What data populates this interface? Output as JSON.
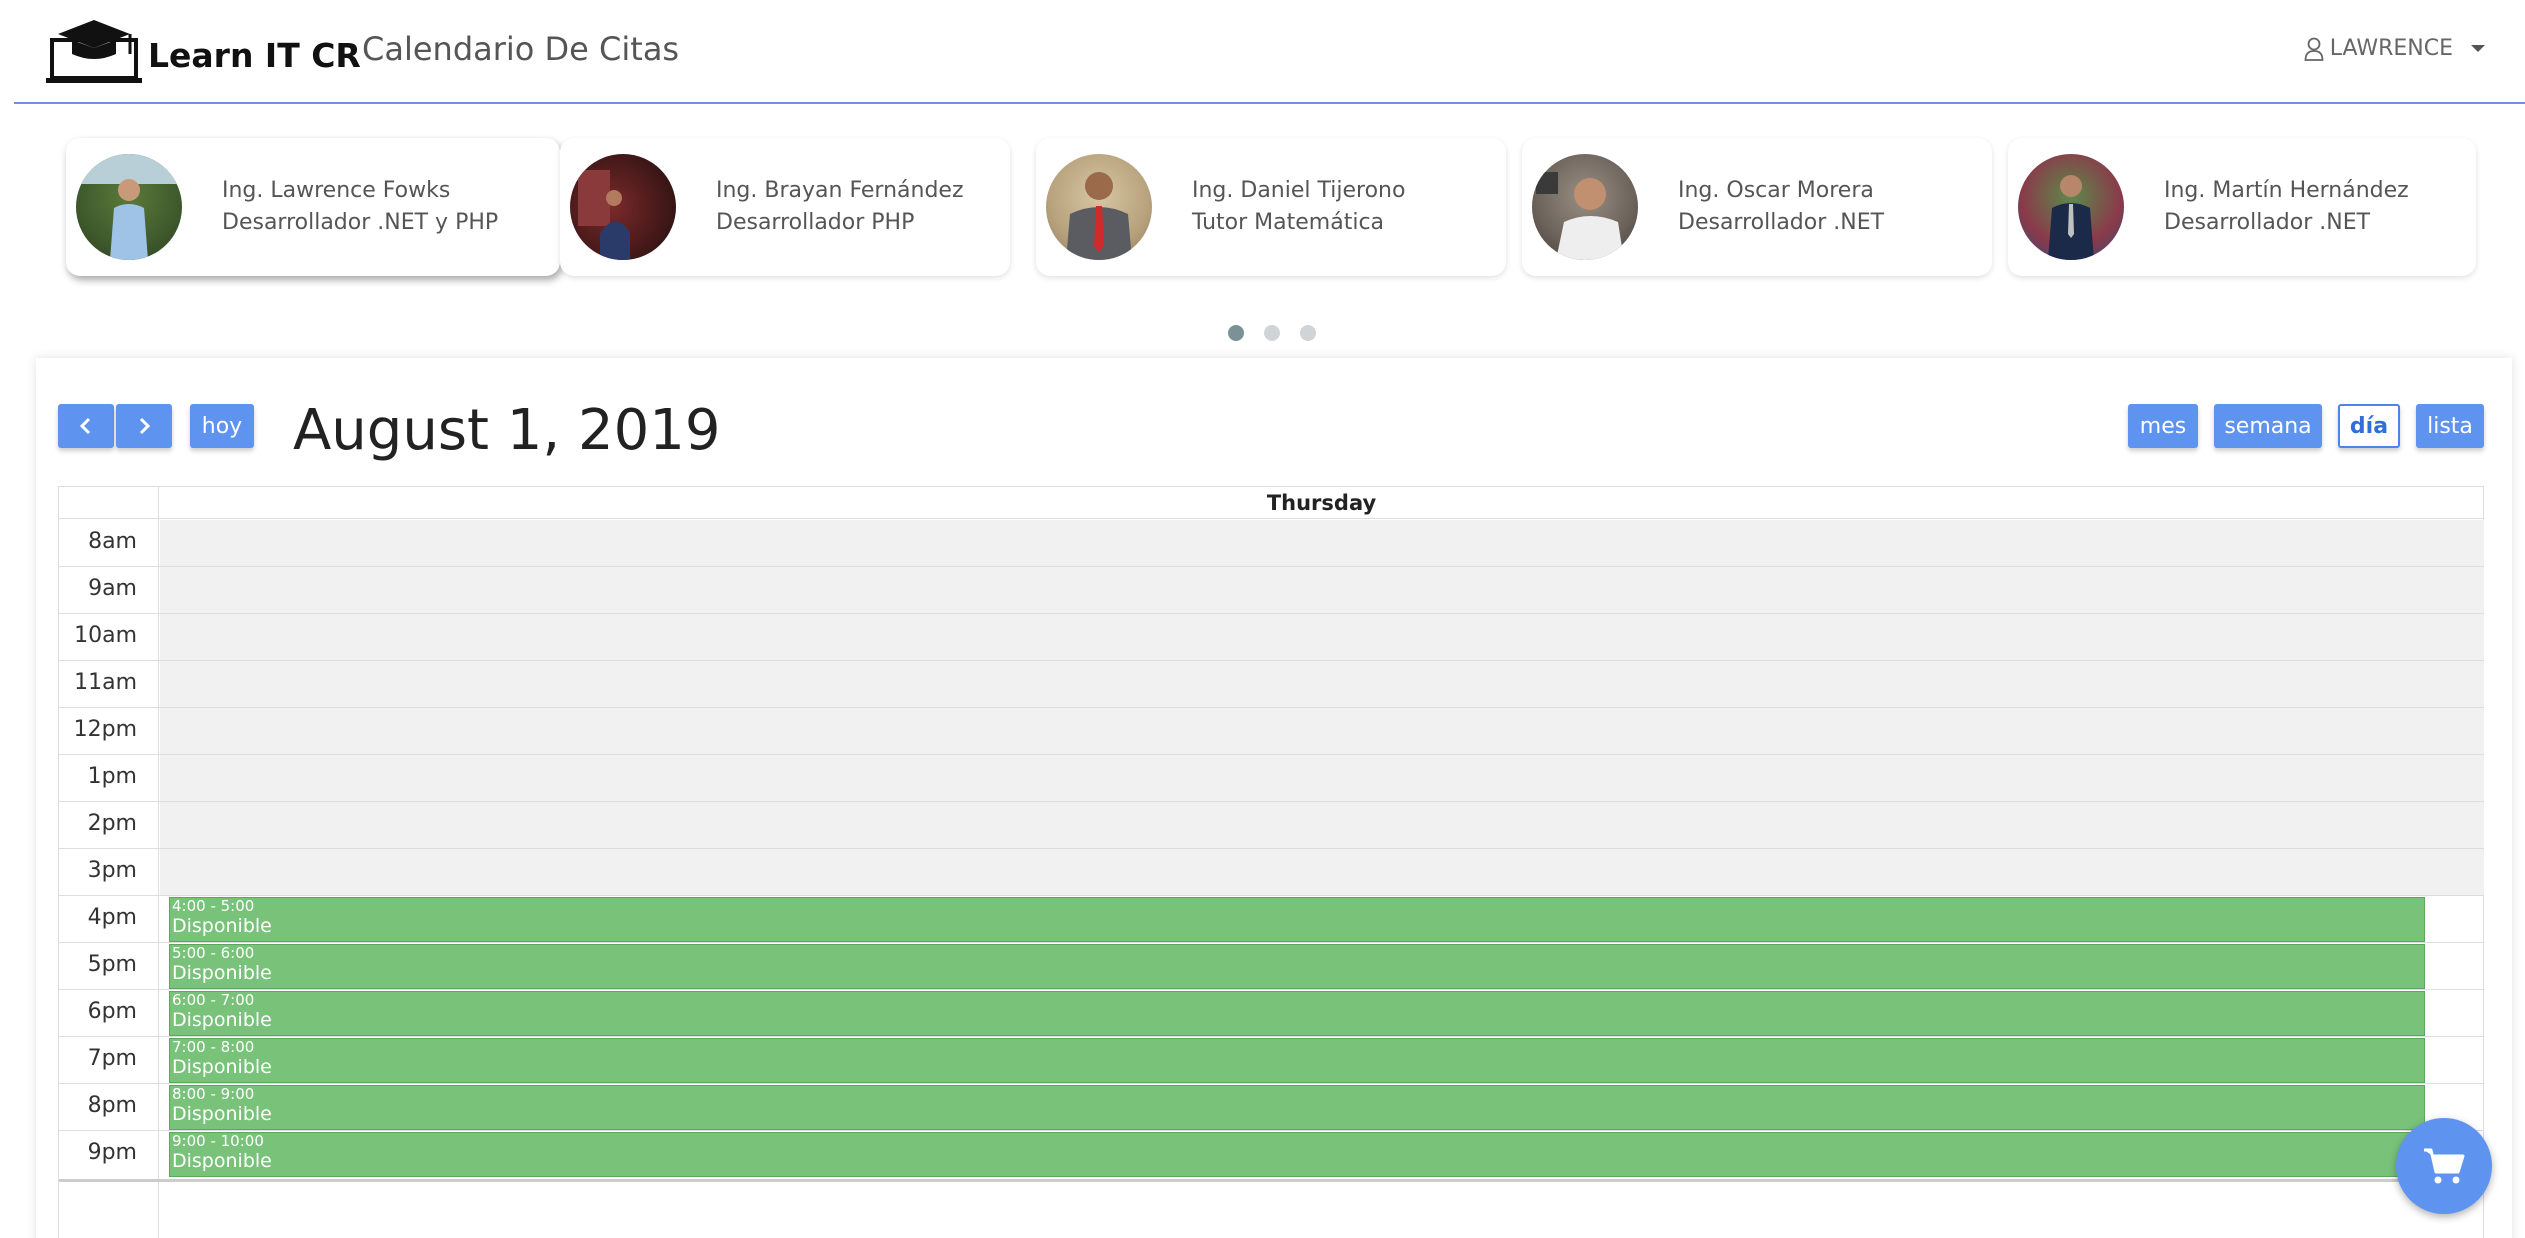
{
  "navbar": {
    "brand": "Learn IT CR",
    "title": "Calendario De Citas",
    "user": "LAWRENCE"
  },
  "tutors": [
    {
      "name": "Ing. Lawrence Fowks",
      "role": "Desarrollador .NET y PHP"
    },
    {
      "name": "Ing. Brayan Fernández",
      "role": "Desarrollador PHP"
    },
    {
      "name": "Ing. Daniel Tijerono",
      "role": "Tutor Matemática"
    },
    {
      "name": "Ing. Oscar Morera",
      "role": "Desarrollador .NET"
    },
    {
      "name": "Ing. Martín Hernández",
      "role": "Desarrollador .NET"
    }
  ],
  "carousel": {
    "pages": 3,
    "active": 1
  },
  "toolbar": {
    "prev_label": "<",
    "next_label": ">",
    "today_label": "hoy",
    "title": "August 1, 2019",
    "views": [
      "mes",
      "semana",
      "día",
      "lista"
    ],
    "active_view": "día"
  },
  "calendar": {
    "day_header": "Thursday",
    "times": [
      "8am",
      "9am",
      "10am",
      "11am",
      "12pm",
      "1pm",
      "2pm",
      "3pm",
      "4pm",
      "5pm",
      "6pm",
      "7pm",
      "8pm",
      "9pm"
    ],
    "events": [
      {
        "time": "4:00 - 5:00",
        "title": "Disponible"
      },
      {
        "time": "5:00 - 6:00",
        "title": "Disponible"
      },
      {
        "time": "6:00 - 7:00",
        "title": "Disponible"
      },
      {
        "time": "7:00 - 8:00",
        "title": "Disponible"
      },
      {
        "time": "8:00 - 9:00",
        "title": "Disponible"
      },
      {
        "time": "9:00 - 10:00",
        "title": "Disponible"
      }
    ]
  },
  "colors": {
    "accent": "#5f93f0",
    "event": "#79c27a",
    "unavailable": "#f1f1f1"
  },
  "icons": {
    "user": "user-icon",
    "cart": "shopping-cart-icon",
    "logo": "graduation-laptop-icon"
  }
}
